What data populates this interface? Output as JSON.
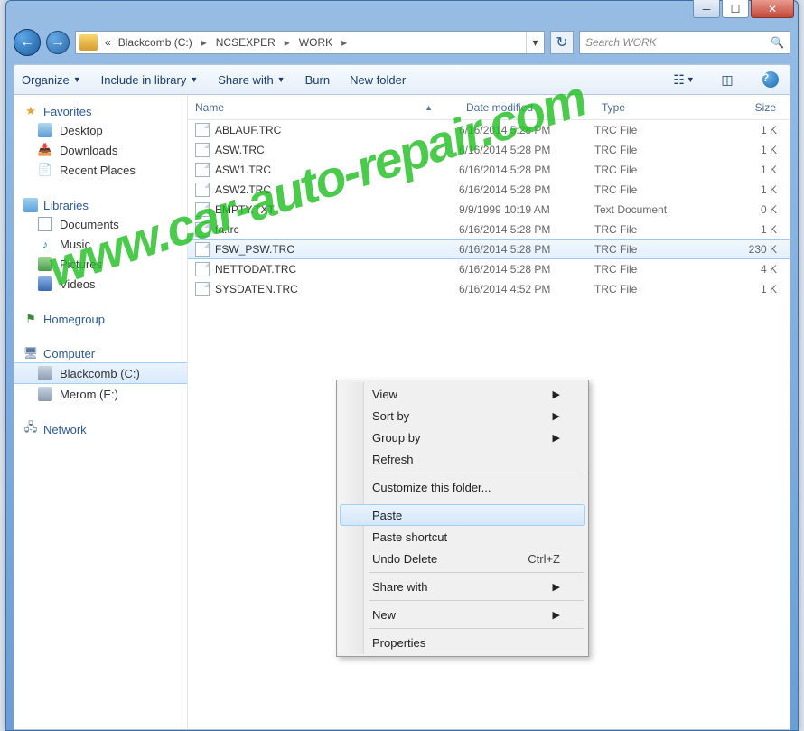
{
  "breadcrumb": {
    "prefix": "«",
    "seg1": "Blackcomb (C:)",
    "seg2": "NCSEXPER",
    "seg3": "WORK"
  },
  "search": {
    "placeholder": "Search WORK"
  },
  "toolbar": {
    "organize": "Organize",
    "include": "Include in library",
    "share": "Share with",
    "burn": "Burn",
    "newfolder": "New folder"
  },
  "sidebar": {
    "favorites": "Favorites",
    "desktop": "Desktop",
    "downloads": "Downloads",
    "recent": "Recent Places",
    "libraries": "Libraries",
    "documents": "Documents",
    "music": "Music",
    "pictures": "Pictures",
    "videos": "Videos",
    "homegroup": "Homegroup",
    "computer": "Computer",
    "drive_c": "Blackcomb (C:)",
    "drive_e": "Merom (E:)",
    "network": "Network"
  },
  "columns": {
    "name": "Name",
    "date": "Date modified",
    "type": "Type",
    "size": "Size"
  },
  "files": [
    {
      "name": "ABLAUF.TRC",
      "date": "6/16/2014 5:28 PM",
      "type": "TRC File",
      "size": "1 K"
    },
    {
      "name": "ASW.TRC",
      "date": "6/16/2014 5:28 PM",
      "type": "TRC File",
      "size": "1 K"
    },
    {
      "name": "ASW1.TRC",
      "date": "6/16/2014 5:28 PM",
      "type": "TRC File",
      "size": "1 K"
    },
    {
      "name": "ASW2.TRC",
      "date": "6/16/2014 5:28 PM",
      "type": "TRC File",
      "size": "1 K"
    },
    {
      "name": "EMPTY.TXT",
      "date": "9/9/1999 10:19 AM",
      "type": "Text Document",
      "size": "0 K"
    },
    {
      "name": "fa.trc",
      "date": "6/16/2014 5:28 PM",
      "type": "TRC File",
      "size": "1 K"
    },
    {
      "name": "FSW_PSW.TRC",
      "date": "6/16/2014 5:28 PM",
      "type": "TRC File",
      "size": "230 K"
    },
    {
      "name": "NETTODAT.TRC",
      "date": "6/16/2014 5:28 PM",
      "type": "TRC File",
      "size": "4 K"
    },
    {
      "name": "SYSDATEN.TRC",
      "date": "6/16/2014 4:52 PM",
      "type": "TRC File",
      "size": "1 K"
    }
  ],
  "selected_file_index": 6,
  "ctx": {
    "view": "View",
    "sortby": "Sort by",
    "groupby": "Group by",
    "refresh": "Refresh",
    "customize": "Customize this folder...",
    "paste": "Paste",
    "paste_shortcut": "Paste shortcut",
    "undo_delete": "Undo Delete",
    "undo_key": "Ctrl+Z",
    "sharewith": "Share with",
    "new": "New",
    "properties": "Properties"
  },
  "watermark": "www.car-auto-repair.com"
}
